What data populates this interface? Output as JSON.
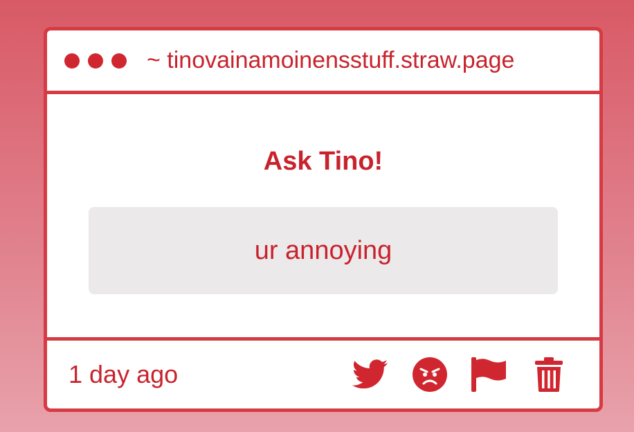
{
  "window": {
    "url": "~ tinovainamoinensstuff.straw.page"
  },
  "main": {
    "heading": "Ask Tino!",
    "message": "ur annoying"
  },
  "footer": {
    "timestamp": "1 day ago",
    "actions": [
      {
        "name": "twitter-icon"
      },
      {
        "name": "angry-face-icon"
      },
      {
        "name": "flag-icon"
      },
      {
        "name": "trash-icon"
      }
    ]
  },
  "colors": {
    "accent": "#d63a42",
    "text": "#c8232d",
    "message_background": "#ebe9ea",
    "card_background": "#ffffff"
  }
}
